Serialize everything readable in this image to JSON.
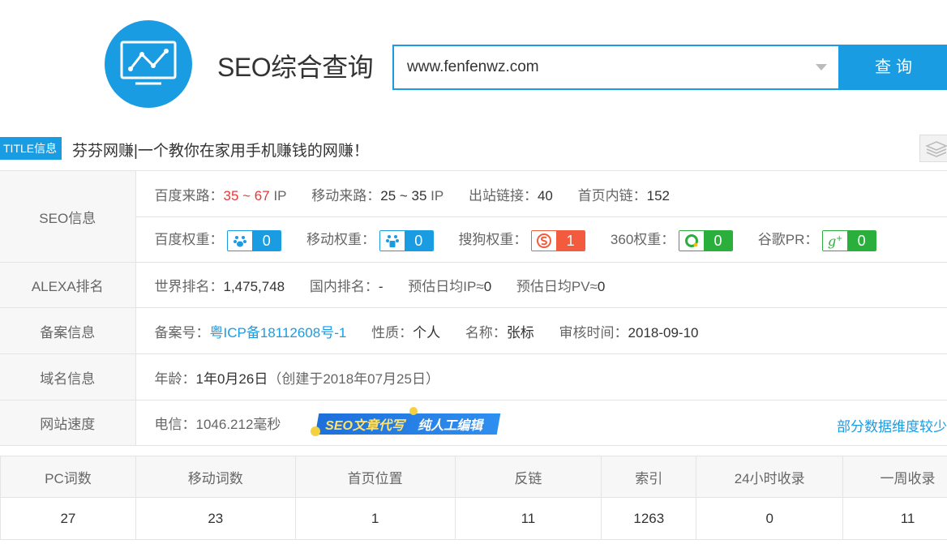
{
  "header": {
    "brand": "SEO综合查询"
  },
  "search": {
    "value": "www.fenfenwz.com",
    "button": "查询"
  },
  "title_info": {
    "badge": "TITLE信息",
    "text": "芬芬网赚|一个教你在家用手机赚钱的网赚！"
  },
  "seo": {
    "label": "SEO信息",
    "baidu_traffic_label": "百度来路：",
    "baidu_traffic_value": "35 ~ 67",
    "baidu_traffic_unit": "IP",
    "mobile_traffic_label": "移动来路：",
    "mobile_traffic_value": "25 ~ 35",
    "mobile_traffic_unit": "IP",
    "outlinks_label": "出站链接：",
    "outlinks_value": "40",
    "inlinks_label": "首页内链：",
    "inlinks_value": "152",
    "weights": [
      {
        "label": "百度权重：",
        "value": "0",
        "icon": "paw-icon",
        "color": "#1a9ce2"
      },
      {
        "label": "移动权重：",
        "value": "0",
        "icon": "paw-mobile-icon",
        "color": "#1a9ce2"
      },
      {
        "label": "搜狗权重：",
        "value": "1",
        "icon": "sogou-icon",
        "color": "#f25b3d"
      },
      {
        "label": "360权重：",
        "value": "0",
        "icon": "360-icon",
        "color": "#2aae3c"
      },
      {
        "label": "谷歌PR：",
        "value": "0",
        "icon": "google-plus-icon",
        "color": "#2aae3c"
      }
    ]
  },
  "alexa": {
    "label": "ALEXA排名",
    "world_label": "世界排名：",
    "world_value": "1,475,748",
    "domestic_label": "国内排名：",
    "domestic_value": "-",
    "ip_label": "预估日均IP≈",
    "ip_value": "0",
    "pv_label": "预估日均PV≈",
    "pv_value": "0"
  },
  "icp": {
    "label": "备案信息",
    "no_label": "备案号：",
    "no_value": "粤ICP备18112608号-1",
    "nature_label": "性质：",
    "nature_value": "个人",
    "name_label": "名称：",
    "name_value": "张标",
    "audit_label": "审核时间：",
    "audit_value": "2018-09-10"
  },
  "domain": {
    "label": "域名信息",
    "age_label": "年龄：",
    "age_value": "1年0月26日",
    "created": "（创建于2018年07月25日）"
  },
  "speed": {
    "label": "网站速度",
    "telecom_label": "电信：",
    "telecom_value": "1046.212毫秒",
    "promo_left": "SEO文章代写",
    "promo_right": "纯人工编辑",
    "right_link": "部分数据维度较少"
  },
  "stats": {
    "headers": [
      "PC词数",
      "移动词数",
      "首页位置",
      "反链",
      "索引",
      "24小时收录",
      "一周收录"
    ],
    "values": [
      "27",
      "23",
      "1",
      "11",
      "1263",
      "0",
      "11"
    ]
  }
}
